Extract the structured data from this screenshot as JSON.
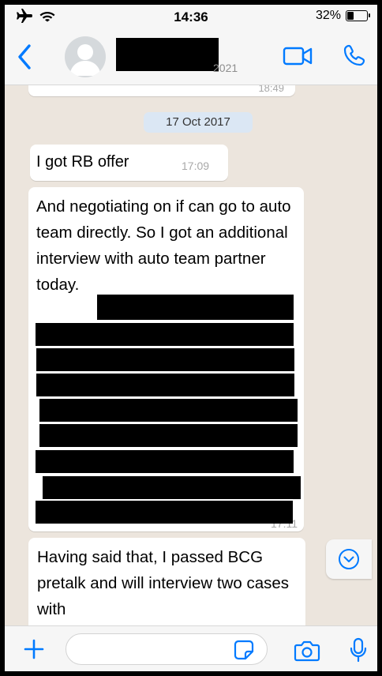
{
  "status_bar": {
    "time": "14:36",
    "battery_text": "32%",
    "battery_level": 0.32,
    "icons": [
      "airplane-mode-icon",
      "wifi-icon",
      "battery-icon"
    ]
  },
  "header": {
    "back_icon": "chevron-left-icon",
    "avatar_icon": "default-avatar-icon",
    "contact_subtitle": "2021",
    "video_icon": "video-call-icon",
    "call_icon": "phone-icon"
  },
  "chat": {
    "previous_message_time": "18:49",
    "date_separator": "17 Oct 2017",
    "messages": [
      {
        "text": "I got RB offer",
        "time": "17:09"
      },
      {
        "text": "And negotiating on if can go to auto team directly. So I got an additional interview with auto team partner today.",
        "time": "17:11"
      },
      {
        "text": "Having said that, I passed BCG pretalk and will interview two cases with",
        "time": ""
      }
    ],
    "scroll_icon": "chevron-down-circle-icon"
  },
  "input_bar": {
    "placeholder": "",
    "icons": [
      "plus-icon",
      "sticker-icon",
      "camera-icon",
      "microphone-icon"
    ]
  },
  "colors": {
    "accent": "#007aff",
    "chat_background": "#ece5dd",
    "bubble": "#ffffff",
    "date_chip": "#dbe7f4",
    "timestamp": "#a8a8a8"
  }
}
